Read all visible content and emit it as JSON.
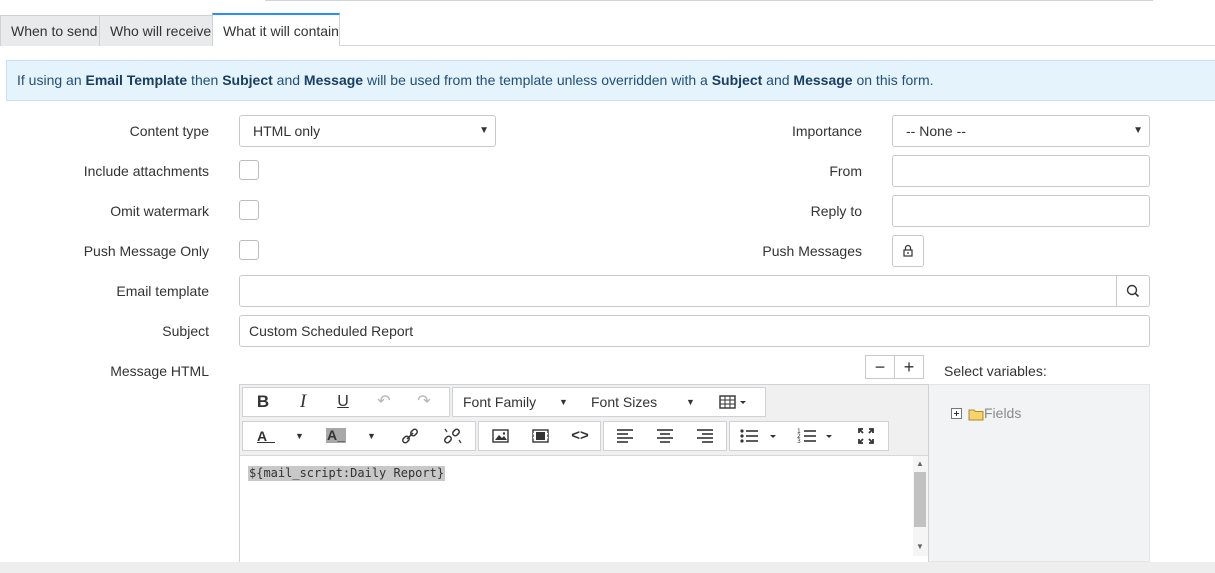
{
  "tabs": [
    {
      "label": "When to send",
      "active": false
    },
    {
      "label": "Who will receive",
      "active": false
    },
    {
      "label": "What it will contain",
      "active": true
    }
  ],
  "banner": {
    "p1": "If using an ",
    "b1": "Email Template",
    "p2": " then ",
    "b2": "Subject",
    "p3": " and ",
    "b3": "Message",
    "p4": " will be used from the template unless overridden with a ",
    "b4": "Subject",
    "p5": " and ",
    "b5": "Message",
    "p6": " on this form."
  },
  "form": {
    "content_type_label": "Content type",
    "content_type_value": "HTML only",
    "include_attachments_label": "Include attachments",
    "omit_watermark_label": "Omit watermark",
    "push_message_only_label": "Push Message Only",
    "email_template_label": "Email template",
    "email_template_value": "",
    "subject_label": "Subject",
    "subject_value": "Custom Scheduled Report",
    "message_html_label": "Message HTML",
    "importance_label": "Importance",
    "importance_value": "-- None --",
    "from_label": "From",
    "from_value": "",
    "reply_to_label": "Reply to",
    "reply_to_value": "",
    "push_messages_label": "Push Messages"
  },
  "editor": {
    "font_family": "Font Family",
    "font_sizes": "Font Sizes",
    "content": "${mail_script:Daily Report}",
    "minus": "−",
    "plus": "+"
  },
  "variables": {
    "title": "Select variables:",
    "tree_root": "Fields"
  },
  "colors": {
    "accent": "#278efc",
    "banner_bg": "#e5f3fd",
    "banner_text": "#1f4f78"
  }
}
